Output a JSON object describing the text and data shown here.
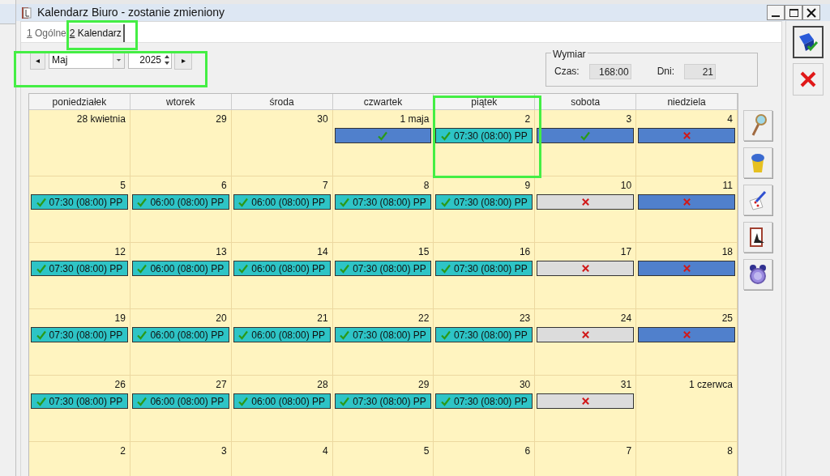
{
  "window": {
    "title": "Kalendarz Biuro - zostanie zmieniony"
  },
  "tabs": [
    {
      "hotkey": "1",
      "label": "Ogólne",
      "selected": false
    },
    {
      "hotkey": "2",
      "label": "Kalendarz",
      "selected": true
    }
  ],
  "navigation": {
    "prev": "◂",
    "month": "Maj",
    "year": "2025",
    "next": "▸"
  },
  "wymiar": {
    "title": "Wymiar",
    "czas_label": "Czas:",
    "czas": "168:00",
    "dni_label": "Dni:",
    "dni": "21"
  },
  "weekdays": [
    "poniedziałek",
    "wtorek",
    "środa",
    "czwartek",
    "piątek",
    "sobota",
    "niedziela"
  ],
  "weeks": [
    [
      {
        "day": "28 kwietnia"
      },
      {
        "day": "29"
      },
      {
        "day": "30"
      },
      {
        "day": "1 maja",
        "entry": {
          "kind": "holiday",
          "ok": true
        }
      },
      {
        "day": "2",
        "entry": {
          "kind": "work",
          "ok": true,
          "text": "07:30 (08:00) PP"
        }
      },
      {
        "day": "3",
        "entry": {
          "kind": "holiday",
          "ok": true
        }
      },
      {
        "day": "4",
        "entry": {
          "kind": "holiday",
          "ok": false
        }
      }
    ],
    [
      {
        "day": "5",
        "entry": {
          "kind": "work",
          "ok": true,
          "text": "07:30 (08:00) PP"
        }
      },
      {
        "day": "6",
        "entry": {
          "kind": "work",
          "ok": true,
          "text": "06:00 (08:00) PP"
        }
      },
      {
        "day": "7",
        "entry": {
          "kind": "work",
          "ok": true,
          "text": "06:00 (08:00) PP"
        }
      },
      {
        "day": "8",
        "entry": {
          "kind": "work",
          "ok": true,
          "text": "07:30 (08:00) PP"
        }
      },
      {
        "day": "9",
        "entry": {
          "kind": "work",
          "ok": true,
          "text": "07:30 (08:00) PP"
        }
      },
      {
        "day": "10",
        "entry": {
          "kind": "off",
          "ok": false
        }
      },
      {
        "day": "11",
        "entry": {
          "kind": "holiday",
          "ok": false
        }
      }
    ],
    [
      {
        "day": "12",
        "entry": {
          "kind": "work",
          "ok": true,
          "text": "07:30 (08:00) PP"
        }
      },
      {
        "day": "13",
        "entry": {
          "kind": "work",
          "ok": true,
          "text": "06:00 (08:00) PP"
        }
      },
      {
        "day": "14",
        "entry": {
          "kind": "work",
          "ok": true,
          "text": "06:00 (08:00) PP"
        }
      },
      {
        "day": "15",
        "entry": {
          "kind": "work",
          "ok": true,
          "text": "07:30 (08:00) PP"
        }
      },
      {
        "day": "16",
        "entry": {
          "kind": "work",
          "ok": true,
          "text": "07:30 (08:00) PP"
        }
      },
      {
        "day": "17",
        "entry": {
          "kind": "off",
          "ok": false
        }
      },
      {
        "day": "18",
        "entry": {
          "kind": "holiday",
          "ok": false
        }
      }
    ],
    [
      {
        "day": "19",
        "entry": {
          "kind": "work",
          "ok": true,
          "text": "07:30 (08:00) PP"
        }
      },
      {
        "day": "20",
        "entry": {
          "kind": "work",
          "ok": true,
          "text": "06:00 (08:00) PP"
        }
      },
      {
        "day": "21",
        "entry": {
          "kind": "work",
          "ok": true,
          "text": "06:00 (08:00) PP"
        }
      },
      {
        "day": "22",
        "entry": {
          "kind": "work",
          "ok": true,
          "text": "07:30 (08:00) PP"
        }
      },
      {
        "day": "23",
        "entry": {
          "kind": "work",
          "ok": true,
          "text": "07:30 (08:00) PP"
        }
      },
      {
        "day": "24",
        "entry": {
          "kind": "off",
          "ok": false
        }
      },
      {
        "day": "25",
        "entry": {
          "kind": "holiday",
          "ok": false
        }
      }
    ],
    [
      {
        "day": "26",
        "entry": {
          "kind": "work",
          "ok": true,
          "text": "07:30 (08:00) PP"
        }
      },
      {
        "day": "27",
        "entry": {
          "kind": "work",
          "ok": true,
          "text": "06:00 (08:00) PP"
        }
      },
      {
        "day": "28",
        "entry": {
          "kind": "work",
          "ok": true,
          "text": "06:00 (08:00) PP"
        }
      },
      {
        "day": "29",
        "entry": {
          "kind": "work",
          "ok": true,
          "text": "07:30 (08:00) PP"
        }
      },
      {
        "day": "30",
        "entry": {
          "kind": "work",
          "ok": true,
          "text": "07:30 (08:00) PP"
        }
      },
      {
        "day": "31",
        "entry": {
          "kind": "off",
          "ok": false
        }
      },
      {
        "day": "1 czerwca"
      }
    ],
    [
      {
        "day": "2"
      },
      {
        "day": "3"
      },
      {
        "day": "4"
      },
      {
        "day": "5"
      },
      {
        "day": "6"
      },
      {
        "day": "7"
      },
      {
        "day": "8"
      }
    ]
  ]
}
